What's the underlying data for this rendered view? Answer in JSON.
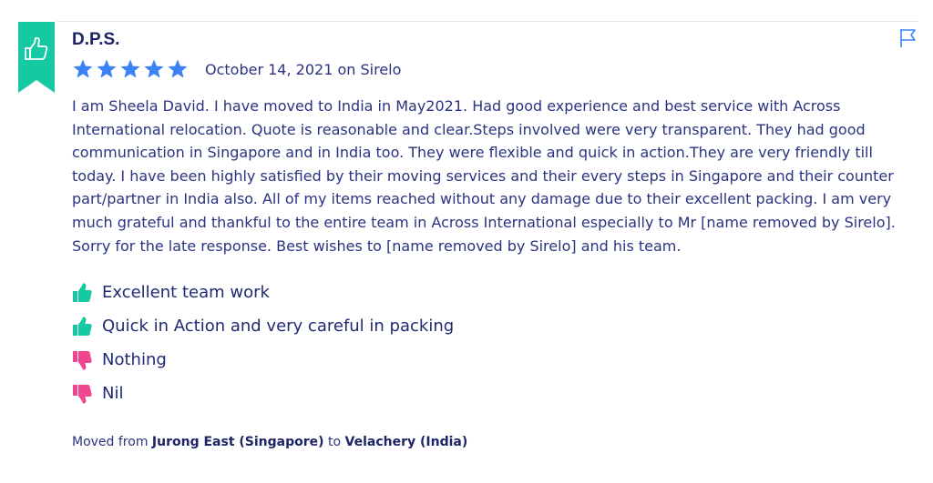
{
  "review": {
    "author": "D.P.S.",
    "rating": 5,
    "rating_max": 5,
    "date": "October 14, 2021",
    "on_word": "on",
    "source": "Sirelo",
    "text": "I am Sheela David. I have moved to India in May2021. Had good experience and best service with Across International relocation. Quote is reasonable and clear.Steps involved were very transparent. They had good communication in Singapore and in India too. They were flexible and quick in action.They are very friendly till today. I have been highly satisfied by their moving services and their every steps in Singapore and their counter part/partner in India also. All of my items reached without any damage due to their excellent packing. I am very much grateful and thankful to the entire team in Across International especially to Mr [name removed by Sirelo]. Sorry for the late response. Best wishes to [name removed by Sirelo] and his team.",
    "pros": [
      "Excellent team work",
      "Quick in Action and very careful in packing"
    ],
    "cons": [
      "Nothing",
      "Nil"
    ],
    "moved_prefix": "Moved from",
    "moved_from": "Jurong East (Singapore)",
    "moved_mid": "to",
    "moved_to": "Velachery (India)"
  },
  "icons": {
    "badge": "thumbs-up-badge-icon",
    "flag": "flag-icon",
    "star": "star-icon",
    "pro": "thumbs-up-icon",
    "con": "thumbs-down-icon"
  },
  "colors": {
    "badge": "#17c9a2",
    "star": "#3b82f6",
    "pro": "#17c9a2",
    "con": "#f0468f",
    "text": "#2a3380",
    "heading": "#1c2467"
  }
}
